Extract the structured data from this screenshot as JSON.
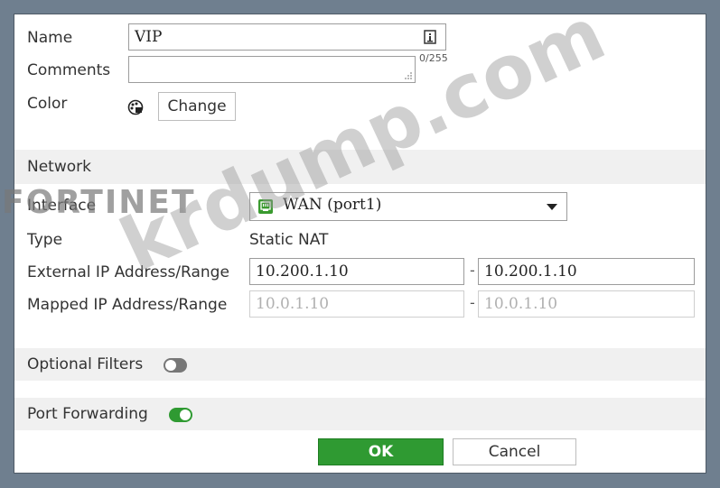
{
  "form": {
    "name_label": "Name",
    "name_value": "VIP",
    "comments_label": "Comments",
    "comments_value": "",
    "comments_counter": "0/255",
    "color_label": "Color",
    "color_change_label": "Change"
  },
  "network": {
    "section_title": "Network",
    "interface_label": "Interface",
    "interface_value": "WAN (port1)",
    "type_label": "Type",
    "type_value": "Static NAT",
    "external_label": "External IP Address/Range",
    "external_start": "10.200.1.10",
    "external_end": "10.200.1.10",
    "mapped_label": "Mapped IP Address/Range",
    "mapped_start": "10.0.1.10",
    "mapped_end": "10.0.1.10",
    "range_separator": "-"
  },
  "optional_filters": {
    "label": "Optional Filters",
    "enabled": false
  },
  "port_forwarding": {
    "label": "Port Forwarding",
    "enabled": true
  },
  "buttons": {
    "ok_label": "OK",
    "cancel_label": "Cancel"
  },
  "watermarks": {
    "brand": "FORTINET",
    "site": "krdump.com"
  },
  "colors": {
    "primary": "#2f9a32",
    "section_bg": "#f0f0f0",
    "interface_icon": "#3a9a2f"
  }
}
